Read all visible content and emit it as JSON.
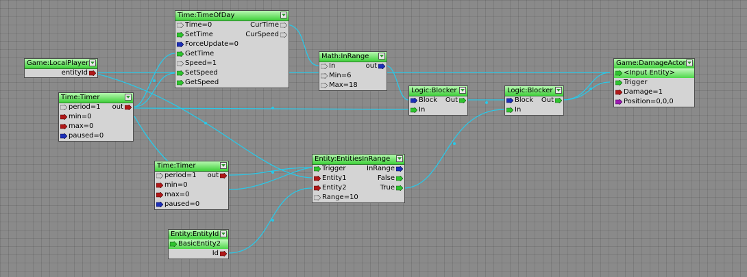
{
  "colors": {
    "background": "#8a8a8a",
    "node_body": "#d4d4d4",
    "title_green": "#3fd03a",
    "edge": "#29c8e8",
    "pin_gray": "#d0d0d0",
    "pin_green": "#2ec52e",
    "pin_blue": "#1b2fb8",
    "pin_red": "#b01818",
    "pin_purple": "#9c1ab0"
  },
  "nodes": {
    "game_local_player": {
      "title": "Game:LocalPlayer",
      "rows": [
        {
          "right": "entityId",
          "out_pin": "red"
        }
      ]
    },
    "time_timeofday": {
      "title": "Time:TimeOfDay",
      "rows": [
        {
          "left": "Time=0",
          "in_pin": "gray",
          "right": "CurTime",
          "out_pin": "gray"
        },
        {
          "left": "SetTime",
          "in_pin": "green",
          "right": "CurSpeed",
          "out_pin": "gray"
        },
        {
          "left": "ForceUpdate=0",
          "in_pin": "blue"
        },
        {
          "left": "GetTime",
          "in_pin": "green"
        },
        {
          "left": "Speed=1",
          "in_pin": "gray"
        },
        {
          "left": "SetSpeed",
          "in_pin": "green"
        },
        {
          "left": "GetSpeed",
          "in_pin": "green"
        }
      ]
    },
    "time_timer_1": {
      "title": "Time:Timer",
      "rows": [
        {
          "left": "period=1",
          "in_pin": "gray",
          "right": "out",
          "out_pin": "red"
        },
        {
          "left": "min=0",
          "in_pin": "red"
        },
        {
          "left": "max=0",
          "in_pin": "red"
        },
        {
          "left": "paused=0",
          "in_pin": "blue"
        }
      ]
    },
    "math_inrange": {
      "title": "Math:InRange",
      "rows": [
        {
          "left": "In",
          "in_pin": "gray",
          "right": "out",
          "out_pin": "blue"
        },
        {
          "left": "Min=6",
          "in_pin": "gray"
        },
        {
          "left": "Max=18",
          "in_pin": "gray"
        }
      ]
    },
    "logic_blocker_1": {
      "title": "Logic:Blocker",
      "rows": [
        {
          "left": "Block",
          "in_pin": "blue",
          "right": "Out",
          "out_pin": "green"
        },
        {
          "left": "In",
          "in_pin": "green"
        }
      ]
    },
    "logic_blocker_2": {
      "title": "Logic:Blocker",
      "rows": [
        {
          "left": "Block",
          "in_pin": "blue",
          "right": "Out",
          "out_pin": "green"
        },
        {
          "left": "In",
          "in_pin": "green"
        }
      ]
    },
    "game_damage_actor": {
      "title": "Game:DamageActor",
      "rows": [
        {
          "left": "<Input Entity>",
          "in_pin": "green",
          "highlight": true
        },
        {
          "left": "Trigger",
          "in_pin": "green"
        },
        {
          "left": "Damage=1",
          "in_pin": "red"
        },
        {
          "left": "Position=0,0,0",
          "in_pin": "purple"
        }
      ]
    },
    "time_timer_2": {
      "title": "Time:Timer",
      "rows": [
        {
          "left": "period=1",
          "in_pin": "gray",
          "right": "out",
          "out_pin": "red"
        },
        {
          "left": "min=0",
          "in_pin": "red"
        },
        {
          "left": "max=0",
          "in_pin": "red"
        },
        {
          "left": "paused=0",
          "in_pin": "blue"
        }
      ]
    },
    "entity_entities_in_range": {
      "title": "Entity:EntitiesInRange",
      "rows": [
        {
          "left": "Trigger",
          "in_pin": "green",
          "right": "InRange",
          "out_pin": "blue"
        },
        {
          "left": "Entity1",
          "in_pin": "red",
          "right": "False",
          "out_pin": "green"
        },
        {
          "left": "Entity2",
          "in_pin": "red",
          "right": "True",
          "out_pin": "green"
        },
        {
          "left": "Range=10",
          "in_pin": "gray"
        }
      ]
    },
    "entity_entityid": {
      "title": "Entity:EntityId",
      "rows": [
        {
          "left": "BasicEntity2",
          "in_pin": "green",
          "highlight": true
        },
        {
          "right": "Id",
          "out_pin": "red"
        }
      ]
    }
  }
}
